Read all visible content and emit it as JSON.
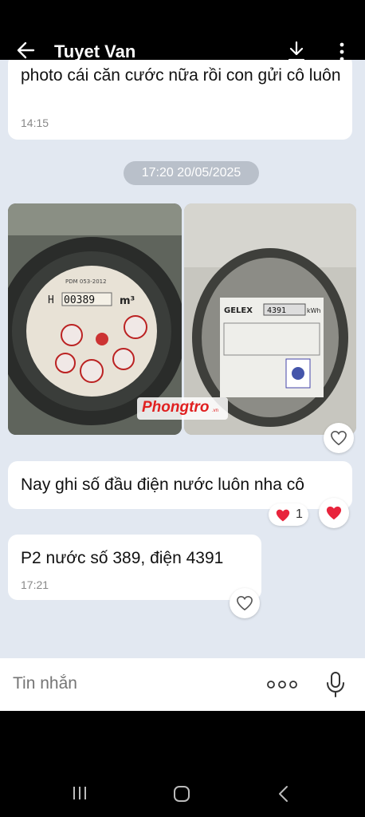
{
  "header": {
    "title": "Tuyet Van",
    "back_icon": "arrow-left-icon",
    "download_icon": "download-icon",
    "more_icon": "more-vertical-icon"
  },
  "messages": [
    {
      "text": "photo cái căn cước nữa rồi con gửi cô luôn",
      "time": "14:15"
    },
    {
      "text": "Nay ghi số đầu điện nước luôn nha cô"
    },
    {
      "text": "P2 nước số 389, điện 4391",
      "time": "17:21"
    }
  ],
  "date_separator": "17:20 20/05/2025",
  "photos": {
    "water_meter": {
      "dial_label": "PDM 053-2012",
      "reading_prefix": "H",
      "reading": "00389",
      "unit": "m³"
    },
    "electric_meter": {
      "brand": "GELEX",
      "reading": "4391",
      "unit": "kWh"
    }
  },
  "watermark": {
    "text": "Phongtro",
    "sub": ".vn"
  },
  "reaction": {
    "emoji": "heart",
    "count": "1"
  },
  "composer": {
    "placeholder": "Tin nhắn",
    "more_icon": "more-horizontal-icon",
    "mic_icon": "microphone-icon"
  },
  "colors": {
    "chat_bg": "#e2e8f1",
    "heart": "#e8243c",
    "date_pill": "#b9c0ca"
  }
}
